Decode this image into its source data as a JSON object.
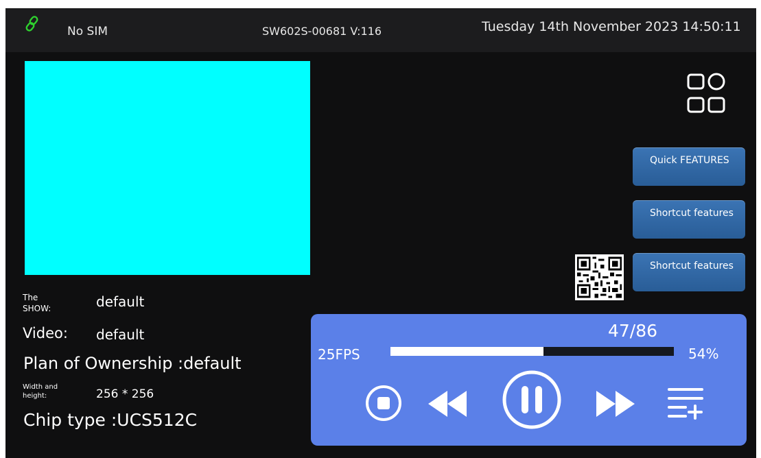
{
  "status_bar": {
    "sim": "No SIM",
    "device": "SW602S-00681 V:116",
    "datetime": "Tuesday 14th November 2023 14:50:11",
    "link_icon": "link-icon",
    "link_color": "#2fd12f"
  },
  "preview": {
    "color": "#00ffff"
  },
  "side_menu": {
    "grid_icon": "apps-grid-icon",
    "buttons": [
      {
        "label": "Quick FEATURES"
      },
      {
        "label": "Shortcut features"
      },
      {
        "label": "Shortcut features"
      }
    ],
    "qr_icon": "qr-code-icon"
  },
  "info": {
    "show_label": "The SHOW:",
    "show_value": "default",
    "video_label": "Video:",
    "video_value": "default",
    "ownership": "Plan of Ownership :default",
    "wh_label": "Width and height:",
    "wh_value": "256 * 256",
    "chip": "Chip type :UCS512C"
  },
  "player": {
    "fps": "25FPS",
    "counter": "47/86",
    "percent_label": "54%",
    "progress": 0.54,
    "accent": "#5b80e8",
    "controls": [
      "stop-icon",
      "rewind-icon",
      "pause-icon",
      "fast-forward-icon",
      "playlist-add-icon"
    ]
  }
}
